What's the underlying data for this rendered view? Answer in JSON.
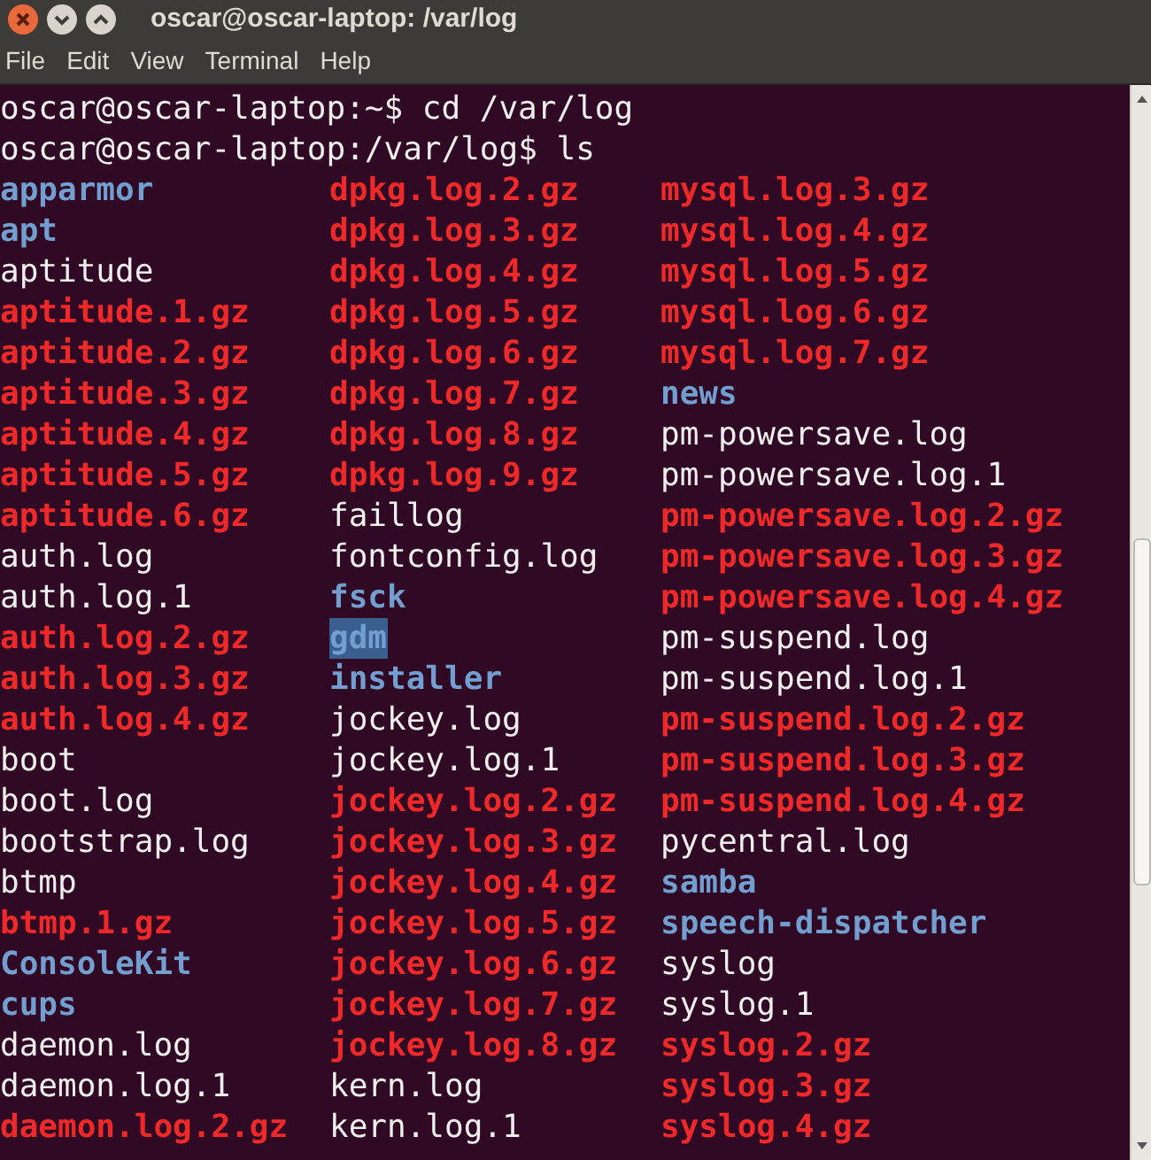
{
  "window": {
    "title": "oscar@oscar-laptop: /var/log"
  },
  "menu": [
    "File",
    "Edit",
    "View",
    "Terminal",
    "Help"
  ],
  "terminal": {
    "commands": [
      {
        "prompt": "oscar@oscar-laptop:~$",
        "command": "cd /var/log"
      },
      {
        "prompt": "oscar@oscar-laptop:/var/log$",
        "command": "ls"
      }
    ],
    "listing": [
      [
        {
          "name": "apparmor",
          "kind": "dir",
          "selected": false
        },
        {
          "name": "apt",
          "kind": "dir",
          "selected": false
        },
        {
          "name": "aptitude",
          "kind": "file",
          "selected": false
        },
        {
          "name": "aptitude.1.gz",
          "kind": "archive",
          "selected": false
        },
        {
          "name": "aptitude.2.gz",
          "kind": "archive",
          "selected": false
        },
        {
          "name": "aptitude.3.gz",
          "kind": "archive",
          "selected": false
        },
        {
          "name": "aptitude.4.gz",
          "kind": "archive",
          "selected": false
        },
        {
          "name": "aptitude.5.gz",
          "kind": "archive",
          "selected": false
        },
        {
          "name": "aptitude.6.gz",
          "kind": "archive",
          "selected": false
        },
        {
          "name": "auth.log",
          "kind": "file",
          "selected": false
        },
        {
          "name": "auth.log.1",
          "kind": "file",
          "selected": false
        },
        {
          "name": "auth.log.2.gz",
          "kind": "archive",
          "selected": false
        },
        {
          "name": "auth.log.3.gz",
          "kind": "archive",
          "selected": false
        },
        {
          "name": "auth.log.4.gz",
          "kind": "archive",
          "selected": false
        },
        {
          "name": "boot",
          "kind": "file",
          "selected": false
        },
        {
          "name": "boot.log",
          "kind": "file",
          "selected": false
        },
        {
          "name": "bootstrap.log",
          "kind": "file",
          "selected": false
        },
        {
          "name": "btmp",
          "kind": "file",
          "selected": false
        },
        {
          "name": "btmp.1.gz",
          "kind": "archive",
          "selected": false
        },
        {
          "name": "ConsoleKit",
          "kind": "dir",
          "selected": false
        },
        {
          "name": "cups",
          "kind": "dir",
          "selected": false
        },
        {
          "name": "daemon.log",
          "kind": "file",
          "selected": false
        },
        {
          "name": "daemon.log.1",
          "kind": "file",
          "selected": false
        },
        {
          "name": "daemon.log.2.gz",
          "kind": "archive",
          "selected": false
        }
      ],
      [
        {
          "name": "dpkg.log.2.gz",
          "kind": "archive",
          "selected": false
        },
        {
          "name": "dpkg.log.3.gz",
          "kind": "archive",
          "selected": false
        },
        {
          "name": "dpkg.log.4.gz",
          "kind": "archive",
          "selected": false
        },
        {
          "name": "dpkg.log.5.gz",
          "kind": "archive",
          "selected": false
        },
        {
          "name": "dpkg.log.6.gz",
          "kind": "archive",
          "selected": false
        },
        {
          "name": "dpkg.log.7.gz",
          "kind": "archive",
          "selected": false
        },
        {
          "name": "dpkg.log.8.gz",
          "kind": "archive",
          "selected": false
        },
        {
          "name": "dpkg.log.9.gz",
          "kind": "archive",
          "selected": false
        },
        {
          "name": "faillog",
          "kind": "file",
          "selected": false
        },
        {
          "name": "fontconfig.log",
          "kind": "file",
          "selected": false
        },
        {
          "name": "fsck",
          "kind": "dir",
          "selected": false
        },
        {
          "name": "gdm",
          "kind": "dir",
          "selected": true
        },
        {
          "name": "installer",
          "kind": "dir",
          "selected": false
        },
        {
          "name": "jockey.log",
          "kind": "file",
          "selected": false
        },
        {
          "name": "jockey.log.1",
          "kind": "file",
          "selected": false
        },
        {
          "name": "jockey.log.2.gz",
          "kind": "archive",
          "selected": false
        },
        {
          "name": "jockey.log.3.gz",
          "kind": "archive",
          "selected": false
        },
        {
          "name": "jockey.log.4.gz",
          "kind": "archive",
          "selected": false
        },
        {
          "name": "jockey.log.5.gz",
          "kind": "archive",
          "selected": false
        },
        {
          "name": "jockey.log.6.gz",
          "kind": "archive",
          "selected": false
        },
        {
          "name": "jockey.log.7.gz",
          "kind": "archive",
          "selected": false
        },
        {
          "name": "jockey.log.8.gz",
          "kind": "archive",
          "selected": false
        },
        {
          "name": "kern.log",
          "kind": "file",
          "selected": false
        },
        {
          "name": "kern.log.1",
          "kind": "file",
          "selected": false
        }
      ],
      [
        {
          "name": "mysql.log.3.gz",
          "kind": "archive",
          "selected": false
        },
        {
          "name": "mysql.log.4.gz",
          "kind": "archive",
          "selected": false
        },
        {
          "name": "mysql.log.5.gz",
          "kind": "archive",
          "selected": false
        },
        {
          "name": "mysql.log.6.gz",
          "kind": "archive",
          "selected": false
        },
        {
          "name": "mysql.log.7.gz",
          "kind": "archive",
          "selected": false
        },
        {
          "name": "news",
          "kind": "dir",
          "selected": false
        },
        {
          "name": "pm-powersave.log",
          "kind": "file",
          "selected": false
        },
        {
          "name": "pm-powersave.log.1",
          "kind": "file",
          "selected": false
        },
        {
          "name": "pm-powersave.log.2.gz",
          "kind": "archive",
          "selected": false
        },
        {
          "name": "pm-powersave.log.3.gz",
          "kind": "archive",
          "selected": false
        },
        {
          "name": "pm-powersave.log.4.gz",
          "kind": "archive",
          "selected": false
        },
        {
          "name": "pm-suspend.log",
          "kind": "file",
          "selected": false
        },
        {
          "name": "pm-suspend.log.1",
          "kind": "file",
          "selected": false
        },
        {
          "name": "pm-suspend.log.2.gz",
          "kind": "archive",
          "selected": false
        },
        {
          "name": "pm-suspend.log.3.gz",
          "kind": "archive",
          "selected": false
        },
        {
          "name": "pm-suspend.log.4.gz",
          "kind": "archive",
          "selected": false
        },
        {
          "name": "pycentral.log",
          "kind": "file",
          "selected": false
        },
        {
          "name": "samba",
          "kind": "dir",
          "selected": false
        },
        {
          "name": "speech-dispatcher",
          "kind": "dir",
          "selected": false
        },
        {
          "name": "syslog",
          "kind": "file",
          "selected": false
        },
        {
          "name": "syslog.1",
          "kind": "file",
          "selected": false
        },
        {
          "name": "syslog.2.gz",
          "kind": "archive",
          "selected": false
        },
        {
          "name": "syslog.3.gz",
          "kind": "archive",
          "selected": false
        },
        {
          "name": "syslog.4.gz",
          "kind": "archive",
          "selected": false
        }
      ]
    ]
  }
}
